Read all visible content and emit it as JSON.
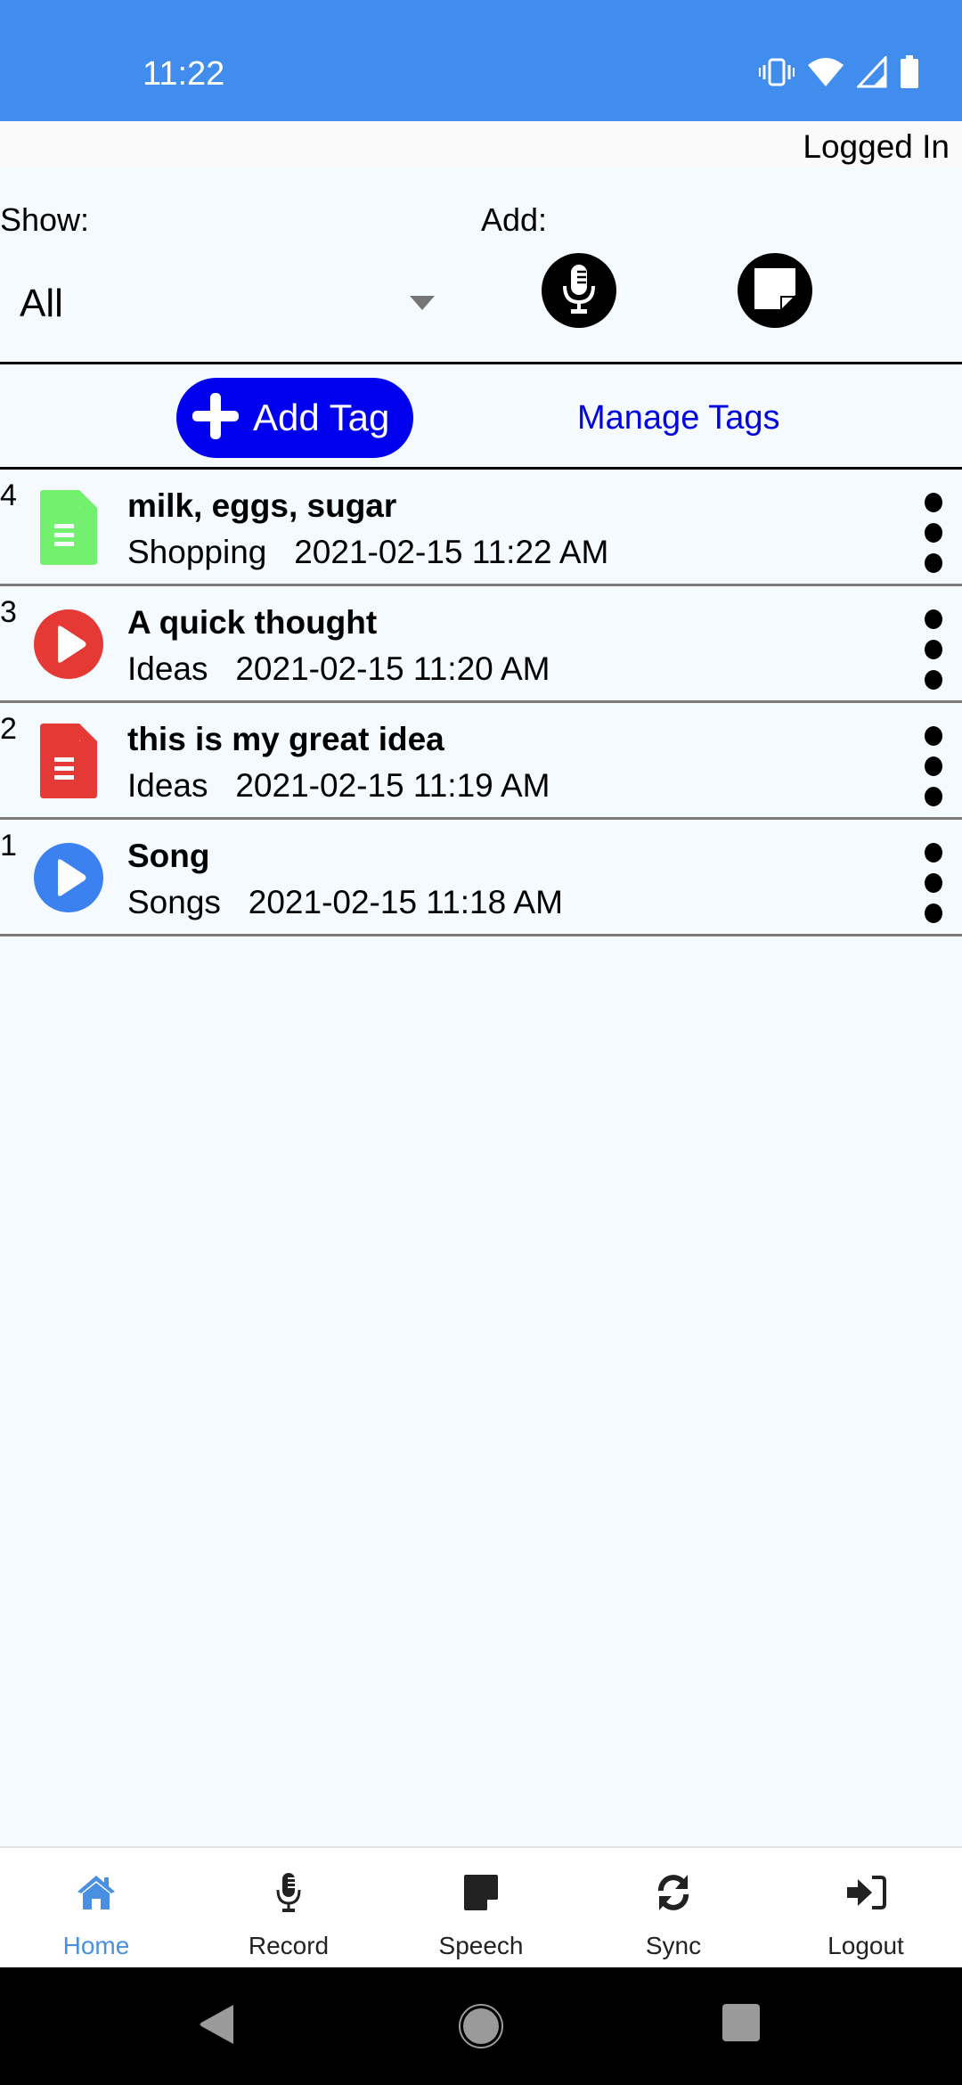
{
  "status_bar": {
    "time": "11:22",
    "icons": [
      "vibrate-icon",
      "wifi-icon",
      "signal-icon",
      "battery-icon"
    ]
  },
  "header": {
    "login_status": "Logged In"
  },
  "filter": {
    "show_label": "Show:",
    "selected_value": "All",
    "add_label": "Add:"
  },
  "add_buttons": [
    {
      "name": "add-recording-button",
      "icon": "microphone-icon"
    },
    {
      "name": "add-note-button",
      "icon": "sticky-note-icon"
    }
  ],
  "tags": {
    "add_tag_label": "Add Tag",
    "manage_tags_label": "Manage Tags",
    "add_tag_color": "#0000ee",
    "manage_tags_color": "#0000e0"
  },
  "items": [
    {
      "number": "4",
      "type": "note",
      "icon_color": "#72f06e",
      "title": "milk, eggs, sugar",
      "tag": "Shopping",
      "datetime": "2021-02-15 11:22 AM"
    },
    {
      "number": "3",
      "type": "audio",
      "icon_color": "#e53935",
      "title": "A quick thought",
      "tag": "Ideas",
      "datetime": "2021-02-15 11:20 AM"
    },
    {
      "number": "2",
      "type": "note",
      "icon_color": "#e53935",
      "title": "this is my great idea",
      "tag": "Ideas",
      "datetime": "2021-02-15 11:19 AM"
    },
    {
      "number": "1",
      "type": "audio",
      "icon_color": "#3b82f0",
      "title": "Song",
      "tag": "Songs",
      "datetime": "2021-02-15 11:18 AM"
    }
  ],
  "tabbar": {
    "active_color": "#4a90e2",
    "tabs": [
      {
        "label": "Home",
        "icon": "home-icon",
        "active": true
      },
      {
        "label": "Record",
        "icon": "microphone-icon",
        "active": false
      },
      {
        "label": "Speech",
        "icon": "sticky-note-icon",
        "active": false
      },
      {
        "label": "Sync",
        "icon": "sync-icon",
        "active": false
      },
      {
        "label": "Logout",
        "icon": "sign-in-icon",
        "active": false
      }
    ]
  },
  "system_nav": [
    "back-button",
    "home-button",
    "recents-button"
  ]
}
